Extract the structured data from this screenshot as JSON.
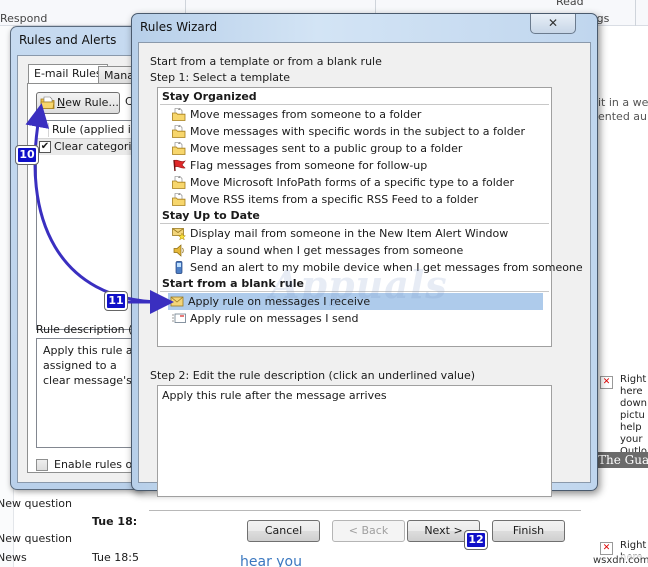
{
  "background": {
    "ribbon": {
      "respond_label": "Respond",
      "read_label": "Read",
      "tags_label": "Tags"
    },
    "right_preview": {
      "line1": "it in a we",
      "line2": "ented au"
    },
    "ads": [
      {
        "text_lines": [
          "Right",
          "here",
          "down",
          "pictu",
          "help",
          "your",
          "Outlo"
        ]
      },
      {
        "text_lines": [
          "Right",
          "here"
        ]
      }
    ],
    "guardian_banner": "The Guardian",
    "mail_rows": [
      {
        "subject": "New question",
        "time": ""
      },
      {
        "subject": "",
        "time": "Tue 18:"
      },
      {
        "subject": "New question",
        "time": ""
      },
      {
        "subject": "News",
        "time": "Tue 18:5"
      }
    ],
    "bottom_partial_text": "hear you"
  },
  "rules_and_alerts": {
    "title": "Rules and Alerts",
    "tabs": [
      {
        "label": "E-mail Rules",
        "active": true
      },
      {
        "label": "Manage Alerts",
        "active": false
      }
    ],
    "new_rule_button": {
      "mnemonic": "N",
      "label_rest": "ew Rule..."
    },
    "change_rule_partial": "Ch",
    "rules_list": {
      "column_header": "Rule (applied in",
      "rows": [
        {
          "checked": true,
          "label": "Clear categories"
        }
      ]
    },
    "description_label": "Rule description (click",
    "description_lines": [
      "Apply this rule after",
      "assigned to a",
      "clear message's ca"
    ],
    "enable_rules": {
      "checked": false,
      "label": "Enable rules on al"
    }
  },
  "rules_wizard": {
    "title": "Rules Wizard",
    "close_icon": "close-icon",
    "intro": "Start from a template or from a blank rule",
    "step1_label": "Step 1: Select a template",
    "groups": [
      {
        "name": "Stay Organized",
        "templates": [
          {
            "icon": "move-to-folder-icon",
            "label": "Move messages from someone to a folder"
          },
          {
            "icon": "move-to-folder-icon",
            "label": "Move messages with specific words in the subject to a folder"
          },
          {
            "icon": "move-to-folder-icon",
            "label": "Move messages sent to a public group to a folder"
          },
          {
            "icon": "flag-icon",
            "label": "Flag messages from someone for follow-up"
          },
          {
            "icon": "move-to-folder-icon",
            "label": "Move Microsoft InfoPath forms of a specific type to a folder"
          },
          {
            "icon": "move-to-folder-icon",
            "label": "Move RSS items from a specific RSS Feed to a folder"
          }
        ]
      },
      {
        "name": "Stay Up to Date",
        "templates": [
          {
            "icon": "new-item-alert-icon",
            "label": "Display mail from someone in the New Item Alert Window"
          },
          {
            "icon": "speaker-icon",
            "label": "Play a sound when I get messages from someone"
          },
          {
            "icon": "mobile-device-icon",
            "label": "Send an alert to my mobile device when I get messages from someone"
          }
        ]
      },
      {
        "name": "Start from a blank rule",
        "templates": [
          {
            "icon": "receive-envelope-icon",
            "label": "Apply rule on messages I receive",
            "selected": true
          },
          {
            "icon": "send-envelope-icon",
            "label": "Apply rule on messages I send"
          }
        ]
      }
    ],
    "step2_label": "Step 2: Edit the rule description (click an underlined value)",
    "rule_description": "Apply this rule after the message arrives",
    "buttons": {
      "cancel": "Cancel",
      "back": "< Back",
      "next": "Next >",
      "finish": "Finish"
    },
    "back_enabled": false
  },
  "annotations": {
    "steps": [
      "10",
      "11",
      "12"
    ],
    "watermark": "Appuals",
    "arrow_color": "#3a2fc0"
  },
  "site_watermark": "wsxdn.com"
}
